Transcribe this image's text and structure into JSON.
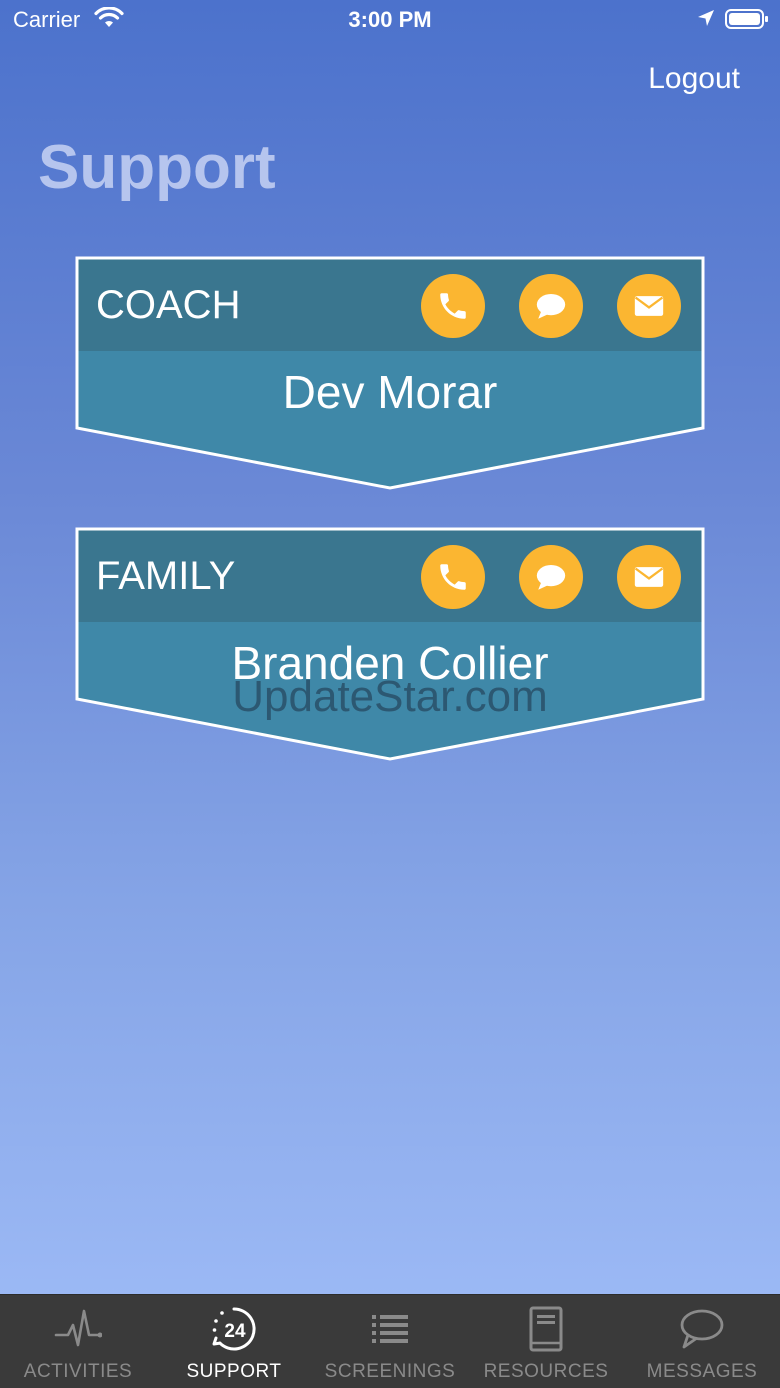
{
  "status_bar": {
    "carrier": "Carrier",
    "time": "3:00 PM"
  },
  "header": {
    "logout_label": "Logout",
    "title": "Support"
  },
  "colors": {
    "card_header": "#3a768f",
    "card_body": "#3f88a8",
    "action_button": "#fbb631",
    "title": "#b6c5ee",
    "tab_bar": "#3a3a3a"
  },
  "cards": [
    {
      "role": "COACH",
      "name": "Dev Morar",
      "actions": [
        "phone-icon",
        "chat-icon",
        "mail-icon"
      ]
    },
    {
      "role": "FAMILY",
      "name": "Branden Collier",
      "actions": [
        "phone-icon",
        "chat-icon",
        "mail-icon"
      ]
    }
  ],
  "watermark": "UpdateStar.com",
  "tabs": [
    {
      "label": "ACTIVITIES",
      "icon": "heartbeat-icon",
      "active": false
    },
    {
      "label": "SUPPORT",
      "icon": "support-24-icon",
      "active": true
    },
    {
      "label": "SCREENINGS",
      "icon": "list-icon",
      "active": false
    },
    {
      "label": "RESOURCES",
      "icon": "book-icon",
      "active": false
    },
    {
      "label": "MESSAGES",
      "icon": "speech-bubble-icon",
      "active": false
    }
  ]
}
